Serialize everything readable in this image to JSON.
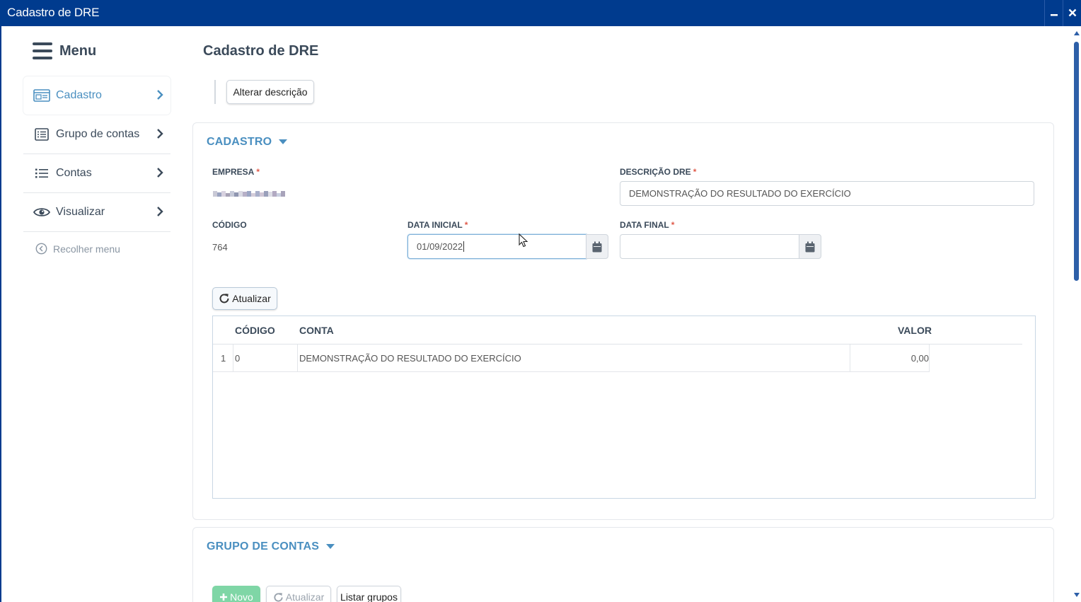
{
  "window": {
    "title": "Cadastro de DRE",
    "minimize": "▁",
    "close": "✕"
  },
  "sidebar": {
    "menu_label": "Menu",
    "items": [
      {
        "label": "Cadastro",
        "icon": "card-icon",
        "active": true
      },
      {
        "label": "Grupo de contas",
        "icon": "list-box-icon",
        "active": false
      },
      {
        "label": "Contas",
        "icon": "list-icon",
        "active": false
      },
      {
        "label": "Visualizar",
        "icon": "eye-icon",
        "active": false
      }
    ],
    "collapse_label": "Recolher menu"
  },
  "page": {
    "title": "Cadastro de DRE"
  },
  "toolbar": {
    "alter_description_label": "Alterar descrição"
  },
  "cadastro": {
    "section_title": "CADASTRO",
    "empresa_label": "EMPRESA",
    "descricao_label": "DESCRIÇÃO DRE",
    "descricao_value": "DEMONSTRAÇÃO DO RESULTADO DO EXERCÍCIO",
    "codigo_label": "CÓDIGO",
    "codigo_value": "764",
    "data_inicial_label": "DATA INICIAL",
    "data_inicial_value": "01/09/2022",
    "data_final_label": "DATA FINAL",
    "data_final_value": "",
    "required_mark": "*",
    "refresh_label": "Atualizar",
    "table": {
      "headers": {
        "codigo": "CÓDIGO",
        "conta": "CONTA",
        "valor": "VALOR"
      },
      "rows": [
        {
          "index": "1",
          "codigo": "0",
          "conta": "DEMONSTRAÇÃO DO RESULTADO DO EXERCÍCIO",
          "valor": "0,00"
        }
      ]
    }
  },
  "grupo_contas": {
    "section_title": "GRUPO DE CONTAS",
    "new_label": "Novo",
    "refresh_label": "Atualizar",
    "list_label": "Listar grupos"
  },
  "colors": {
    "titlebar": "#003b8e",
    "accent": "#4a8fc0",
    "required": "#e05a4a",
    "new_button": "#7fd6a6"
  }
}
